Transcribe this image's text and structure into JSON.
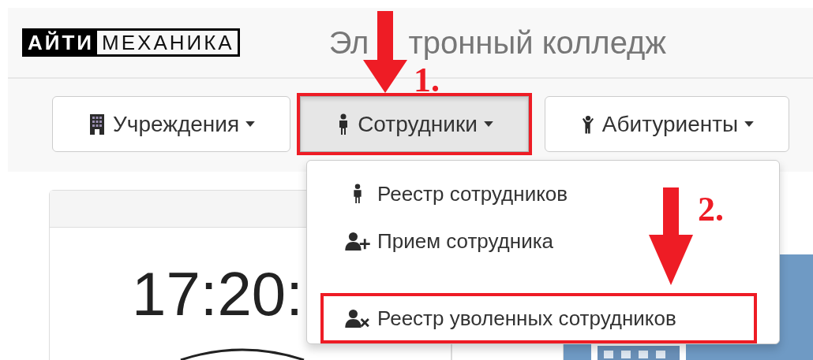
{
  "header": {
    "logo": {
      "dark_part": "АЙТИ",
      "light_part": "МЕХАНИКА"
    },
    "title_parts": [
      "Эл",
      "тронный колледж"
    ]
  },
  "nav_buttons": [
    {
      "label": "Учреждения",
      "kind": "building",
      "selected": false,
      "highlighted": false
    },
    {
      "label": "Сотрудники",
      "kind": "person",
      "selected": true,
      "highlighted": true
    },
    {
      "label": "Абитуриенты",
      "kind": "child",
      "selected": false,
      "highlighted": false
    }
  ],
  "dropdown": {
    "items": [
      {
        "kind": "person",
        "label": "Реестр сотрудников",
        "highlighted": false
      },
      {
        "kind": "add",
        "label": "Прием сотрудника",
        "highlighted": false
      },
      {
        "kind": "divider"
      },
      {
        "kind": "remove",
        "label": "Реестр уволенных сотрудников",
        "highlighted": true
      }
    ]
  },
  "clock_time": "17:20:",
  "annotations": [
    {
      "label": "1."
    },
    {
      "label": "2."
    }
  ]
}
